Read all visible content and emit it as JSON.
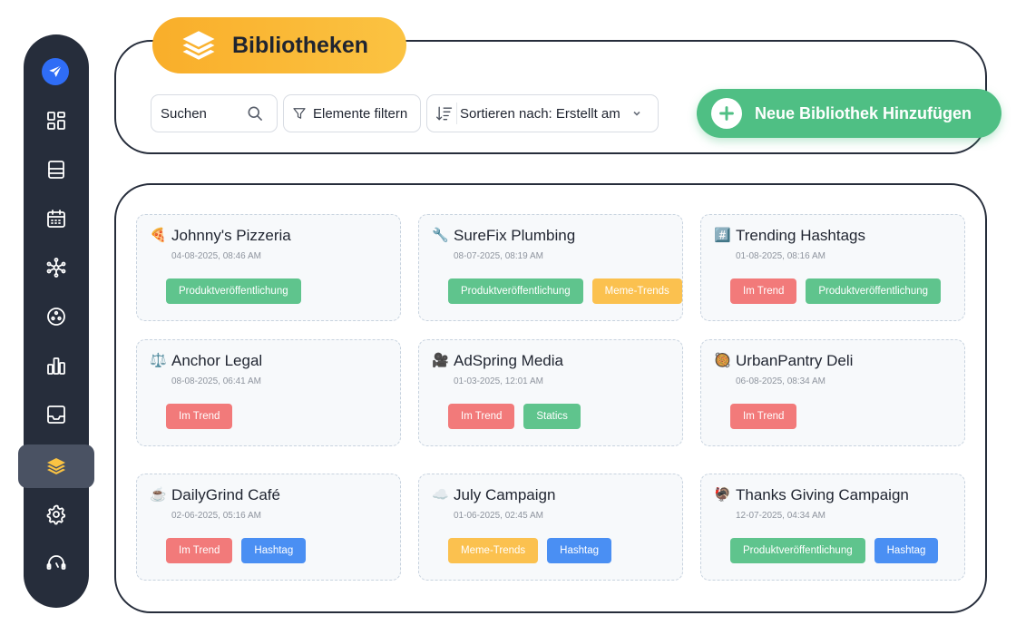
{
  "header": {
    "title": "Bibliotheken"
  },
  "toolbar": {
    "search_label": "Suchen",
    "filter_label": "Elemente filtern",
    "sort_label": "Sortieren nach: Erstellt am",
    "add_label": "Neue Bibliothek Hinzufügen"
  },
  "sidebar": {
    "items": [
      {
        "icon": "dashboard-icon"
      },
      {
        "icon": "book-icon"
      },
      {
        "icon": "calendar-icon"
      },
      {
        "icon": "network-icon"
      },
      {
        "icon": "circle-dots-icon"
      },
      {
        "icon": "bar-chart-icon"
      },
      {
        "icon": "inbox-icon"
      },
      {
        "icon": "layers-icon",
        "active": true
      },
      {
        "icon": "gear-icon"
      },
      {
        "icon": "support-icon"
      }
    ]
  },
  "colors": {
    "accent": "#fbb634",
    "primary_green": "#4fbf84",
    "sidebar_bg": "#262d3b"
  },
  "libraries": [
    {
      "emoji": "🍕",
      "name": "Johnny's Pizzeria",
      "date": "04-08-2025, 08:46 AM",
      "tags": [
        {
          "label": "Produktveröffentlichung",
          "color": "green"
        }
      ]
    },
    {
      "emoji": "🔧",
      "name": "SureFix Plumbing",
      "date": "08-07-2025, 08:19 AM",
      "tags": [
        {
          "label": "Produktveröffentlichung",
          "color": "green"
        },
        {
          "label": "Meme-Trends",
          "color": "orange"
        }
      ]
    },
    {
      "emoji": "#️⃣",
      "name": "Trending Hashtags",
      "date": "01-08-2025, 08:16 AM",
      "tags": [
        {
          "label": "Im Trend",
          "color": "red"
        },
        {
          "label": "Produktveröffentlichung",
          "color": "green"
        }
      ]
    },
    {
      "emoji": "⚖️",
      "name": "Anchor Legal",
      "date": "08-08-2025, 06:41 AM",
      "tags": [
        {
          "label": "Im Trend",
          "color": "red"
        }
      ]
    },
    {
      "emoji": "🎥",
      "name": "AdSpring Media",
      "date": "01-03-2025, 12:01 AM",
      "tags": [
        {
          "label": "Im Trend",
          "color": "red"
        },
        {
          "label": "Statics",
          "color": "teal"
        }
      ]
    },
    {
      "emoji": "🥘",
      "name": "UrbanPantry Deli",
      "date": "06-08-2025, 08:34 AM",
      "tags": [
        {
          "label": "Im Trend",
          "color": "red"
        }
      ]
    },
    {
      "emoji": "☕",
      "name": "DailyGrind Café",
      "date": "02-06-2025, 05:16 AM",
      "tags": [
        {
          "label": "Im Trend",
          "color": "red"
        },
        {
          "label": "Hashtag",
          "color": "blue"
        }
      ]
    },
    {
      "emoji": "☁️",
      "name": "July Campaign",
      "date": "01-06-2025, 02:45 AM",
      "tags": [
        {
          "label": "Meme-Trends",
          "color": "orange"
        },
        {
          "label": "Hashtag",
          "color": "blue"
        }
      ]
    },
    {
      "emoji": "🦃",
      "name": "Thanks Giving Campaign",
      "date": "12-07-2025, 04:34 AM",
      "tags": [
        {
          "label": "Produktveröffentlichung",
          "color": "green"
        },
        {
          "label": "Hashtag",
          "color": "blue"
        }
      ]
    }
  ]
}
